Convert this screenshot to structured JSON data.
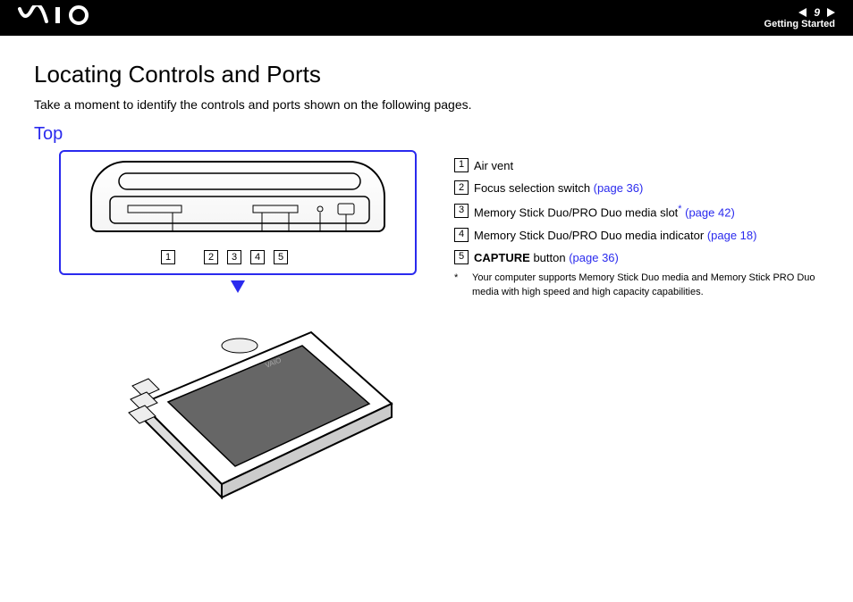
{
  "header": {
    "logo": "VAIO",
    "page_number": "9",
    "section": "Getting Started"
  },
  "title": "Locating Controls and Ports",
  "intro": "Take a moment to identify the controls and ports shown on the following pages.",
  "subheading": "Top",
  "callout_numbers": [
    "1",
    "2",
    "3",
    "4",
    "5"
  ],
  "legend": [
    {
      "num": "1",
      "text": "Air vent",
      "link": ""
    },
    {
      "num": "2",
      "text": "Focus selection switch ",
      "link": "(page 36)"
    },
    {
      "num": "3",
      "text": "Memory Stick Duo/PRO Duo media slot",
      "star": "*",
      "link": " (page 42)"
    },
    {
      "num": "4",
      "text": "Memory Stick Duo/PRO Duo media indicator ",
      "link": "(page 18)"
    },
    {
      "num": "5",
      "text_bold": "CAPTURE",
      "text": " button ",
      "link": "(page 36)"
    }
  ],
  "footnote": {
    "mark": "*",
    "text": "Your computer supports Memory Stick Duo media and Memory Stick PRO Duo media with high speed and high capacity capabilities."
  }
}
